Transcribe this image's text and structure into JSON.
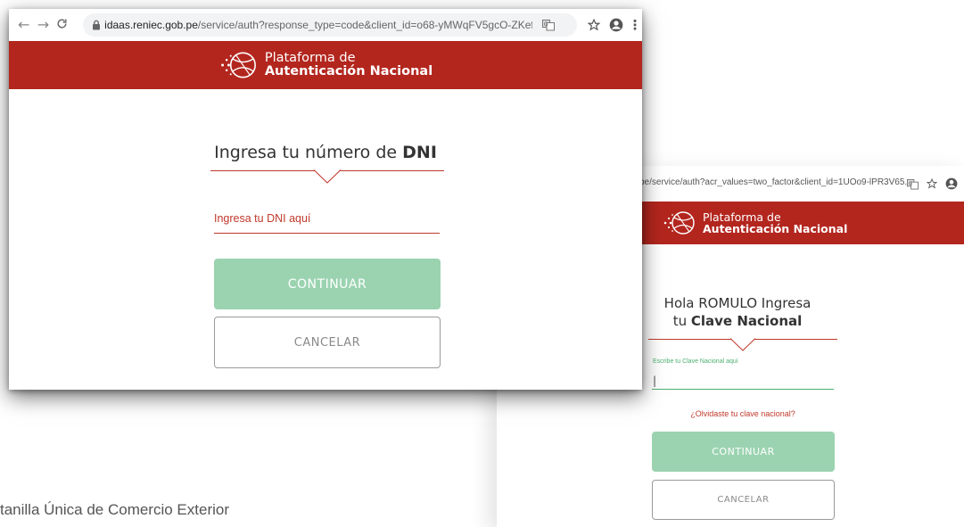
{
  "background": {
    "caption": "tanilla Única de Comercio Exterior"
  },
  "window1": {
    "url_host": "idaas.reniec.gob.pe",
    "url_path": "/service/auth?response_type=code&client_id=o68-yMWqFV5gcO-ZKef...",
    "brand_line1": "Plataforma de",
    "brand_line2": "Autenticación Nacional",
    "heading_prefix": "Ingresa tu número de ",
    "heading_strong": "DNI",
    "input_placeholder": "Ingresa tu DNI aquí",
    "continue_label": "CONTINUAR",
    "cancel_label": "CANCELAR"
  },
  "window2": {
    "url_text": "pe/service/auth?acr_values=two_factor&client_id=1UOo9-lPR3V65...",
    "brand_line1": "Plataforma de",
    "brand_line2": "Autenticación Nacional",
    "heading_line1": "Hola ROMULO Ingresa",
    "heading_line2_prefix": "tu ",
    "heading_line2_strong": "Clave Nacional",
    "input_label": "Escribe tu Clave Nacional aquí",
    "input_value": "|",
    "forgot_link": "¿Olvidaste tu clave nacional?",
    "continue_label": "CONTINUAR",
    "cancel_label": "CANCELAR"
  },
  "colors": {
    "brand_red": "#b3261e",
    "primary_button": "#9bd3b1",
    "accent_green": "#4caf6e",
    "field_red": "#c0392b"
  },
  "icons": [
    "back-arrow-icon",
    "forward-arrow-icon",
    "reload-icon",
    "lock-icon",
    "translate-icon",
    "star-icon",
    "account-icon",
    "kebab-menu-icon",
    "platform-logo-icon"
  ]
}
